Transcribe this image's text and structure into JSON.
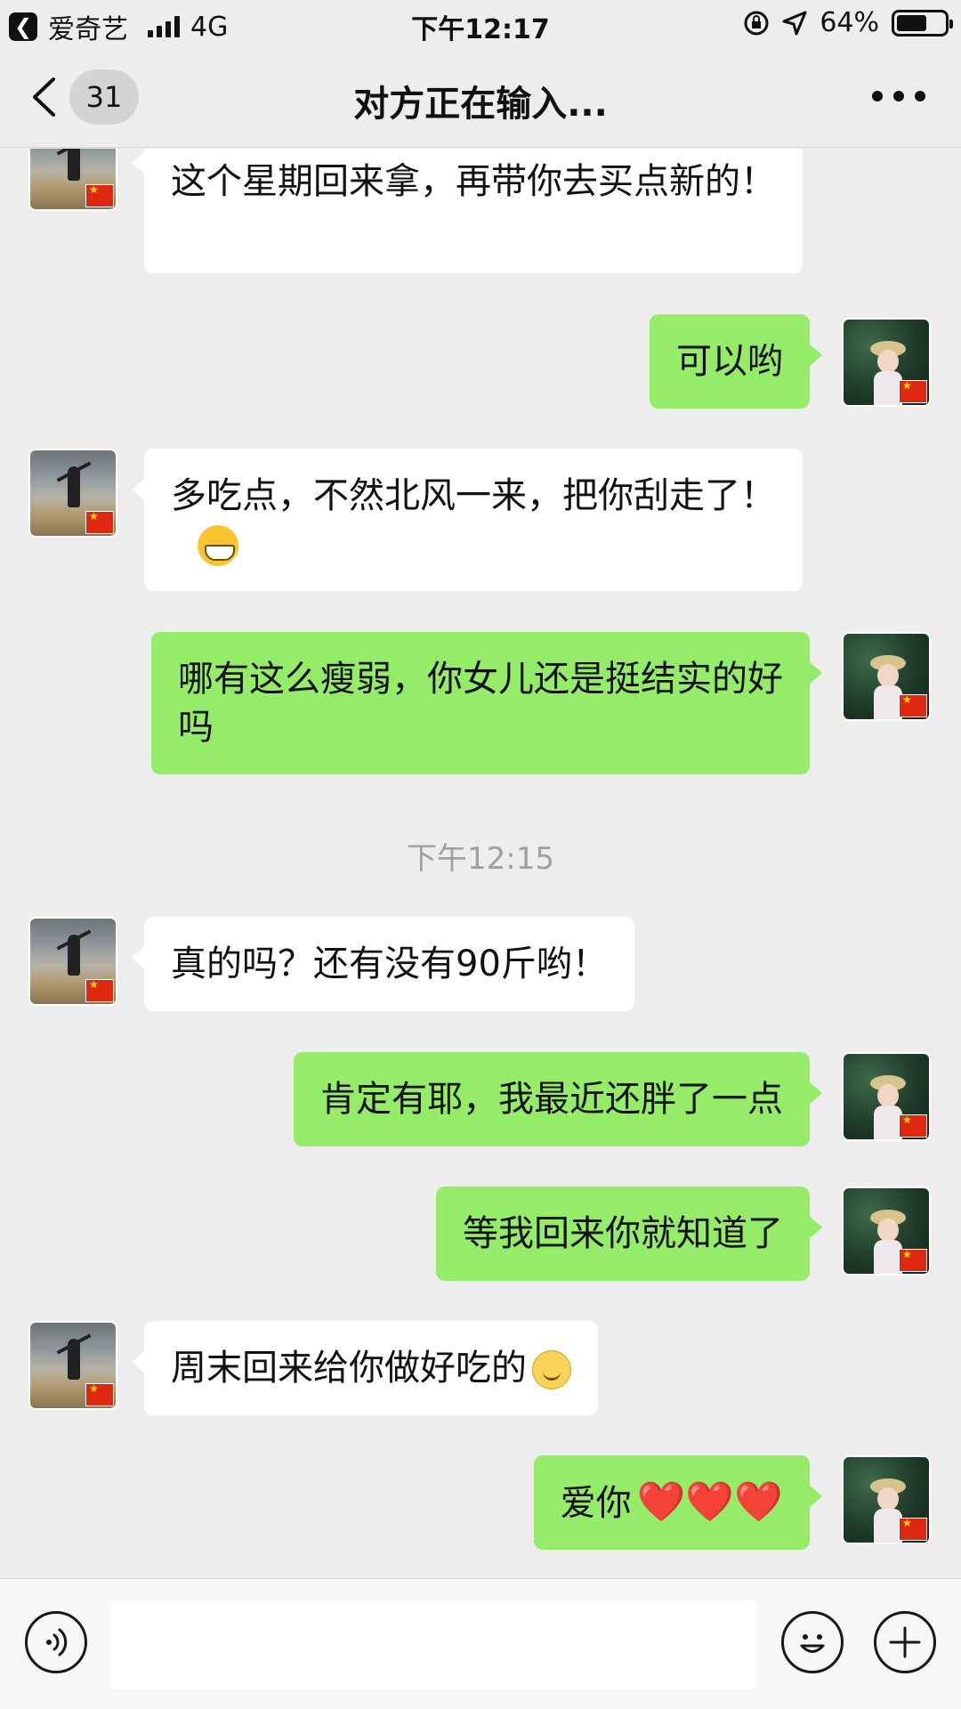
{
  "status_bar": {
    "back_app_label": "爱奇艺",
    "network": "4G",
    "time": "下午12:17",
    "battery": "64%",
    "battery_level": 0.64
  },
  "nav": {
    "unread_count": "31",
    "title": "对方正在输入..."
  },
  "messages": [
    {
      "side": "in",
      "text": "这个星期回来拿，再带你去买点新的！"
    },
    {
      "side": "out",
      "text": "可以哟"
    },
    {
      "side": "in",
      "text": "多吃点，不然北风一来，把你刮走了！",
      "emoji": "grinning-face"
    },
    {
      "side": "out",
      "text": "哪有这么瘦弱，你女儿还是挺结实的好吗"
    },
    {
      "timestamp": "下午12:15"
    },
    {
      "side": "in",
      "text": "真的吗？还有没有90斤哟！"
    },
    {
      "side": "out",
      "text": "肯定有耶，我最近还胖了一点"
    },
    {
      "side": "out",
      "text": "等我回来你就知道了"
    },
    {
      "side": "in",
      "text": "周末回来给你做好吃的",
      "emoji": "smiling-face"
    },
    {
      "side": "out",
      "text": "爱你",
      "emoji": "❤️❤️❤️"
    }
  ],
  "input_bar": {
    "placeholder": "",
    "icons": [
      "voice-icon",
      "emoji-icon",
      "plus-icon"
    ]
  },
  "colors": {
    "background": "#ededed",
    "incoming_bubble": "#ffffff",
    "outgoing_bubble": "#95ec69",
    "timestamp": "#a0a0a0"
  }
}
